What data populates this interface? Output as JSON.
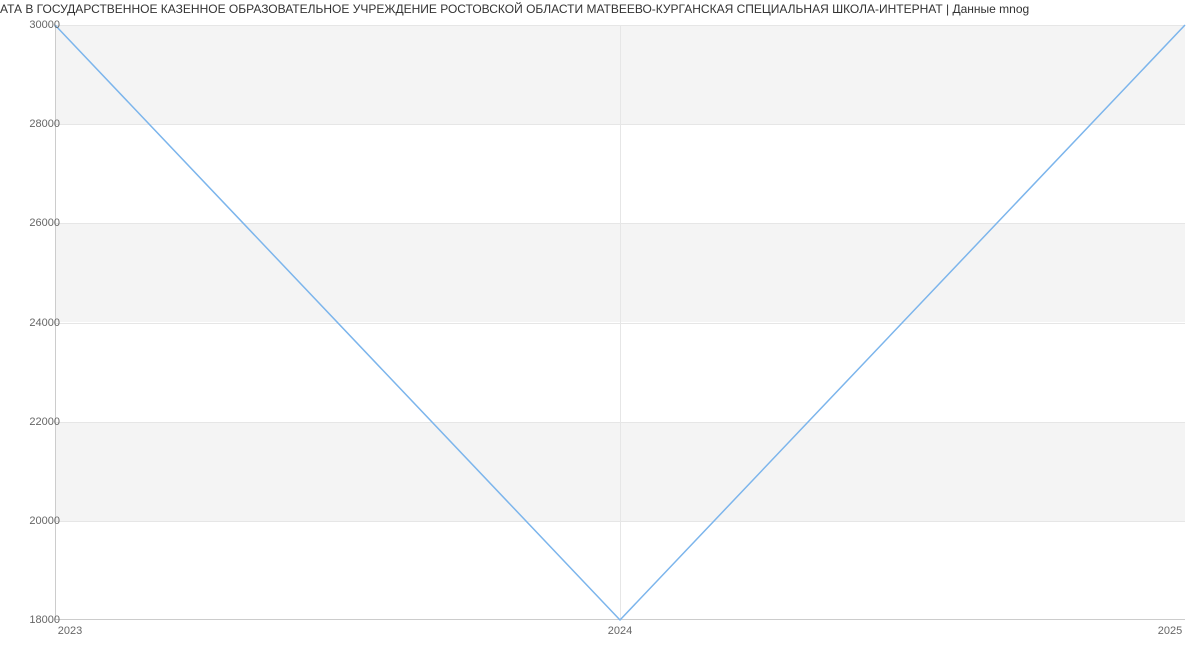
{
  "title": "АТА В ГОСУДАРСТВЕННОЕ КАЗЕННОЕ ОБРАЗОВАТЕЛЬНОЕ УЧРЕЖДЕНИЕ РОСТОВСКОЙ ОБЛАСТИ МАТВЕЕВО-КУРГАНСКАЯ СПЕЦИАЛЬНАЯ ШКОЛА-ИНТЕРНАТ | Данные mnog",
  "chart_data": {
    "type": "line",
    "categories": [
      "2023",
      "2024",
      "2025"
    ],
    "values": [
      30000,
      18000,
      30000
    ],
    "title": "АТА В ГОСУДАРСТВЕННОЕ КАЗЕННОЕ ОБРАЗОВАТЕЛЬНОЕ УЧРЕЖДЕНИЕ РОСТОВСКОЙ ОБЛАСТИ МАТВЕЕВО-КУРГАНСКАЯ СПЕЦИАЛЬНАЯ ШКОЛА-ИНТЕРНАТ | Данные mnog",
    "xlabel": "",
    "ylabel": "",
    "ylim": [
      18000,
      30000
    ],
    "y_ticks": [
      18000,
      20000,
      22000,
      24000,
      26000,
      28000,
      30000
    ],
    "line_color": "#7cb5ec"
  },
  "y_tick_labels": {
    "t0": "18000",
    "t1": "20000",
    "t2": "22000",
    "t3": "24000",
    "t4": "26000",
    "t5": "28000",
    "t6": "30000"
  },
  "x_tick_labels": {
    "x0": "2023",
    "x1": "2024",
    "x2": "2025"
  }
}
